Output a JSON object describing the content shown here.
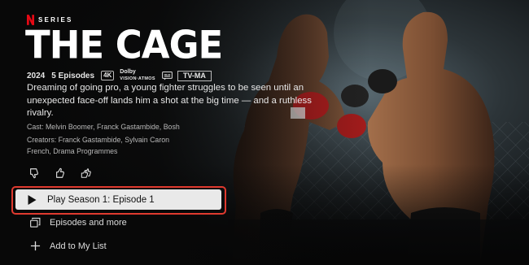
{
  "brand": {
    "series_label": "SERIES"
  },
  "show": {
    "title": "THE CAGE",
    "year": "2024",
    "episodes": "5 Episodes",
    "quality_badge": "4K",
    "audio_line1": "Dolby",
    "audio_line2": "VISION·ATMOS",
    "rating": "TV-MA",
    "description": "Dreaming of going pro, a young fighter struggles to be seen until an unexpected face-off lands him a shot at the big time — and a ruthless rivalry.",
    "cast": "Cast: Melvin Boomer, Franck Gastambide, Bosh",
    "creators": "Creators: Franck Gastambide, Sylvain Caron French, Drama Programmes"
  },
  "actions": {
    "play_label": "Play Season 1: Episode 1",
    "episodes_label": "Episodes and more",
    "mylist_label": "Add to My List"
  },
  "icons": {
    "thumbs_down": "thumbs-down-icon",
    "thumbs_up": "thumbs-up-icon",
    "double_thumbs_up": "double-thumbs-up-icon",
    "subtitles": "subtitles-icon",
    "play": "play-icon",
    "episodes": "episodes-stack-icon",
    "add": "plus-icon"
  },
  "colors": {
    "brand_red": "#e50914",
    "focus_outline": "#e03a2f",
    "button_bg": "#e9e9e9"
  }
}
